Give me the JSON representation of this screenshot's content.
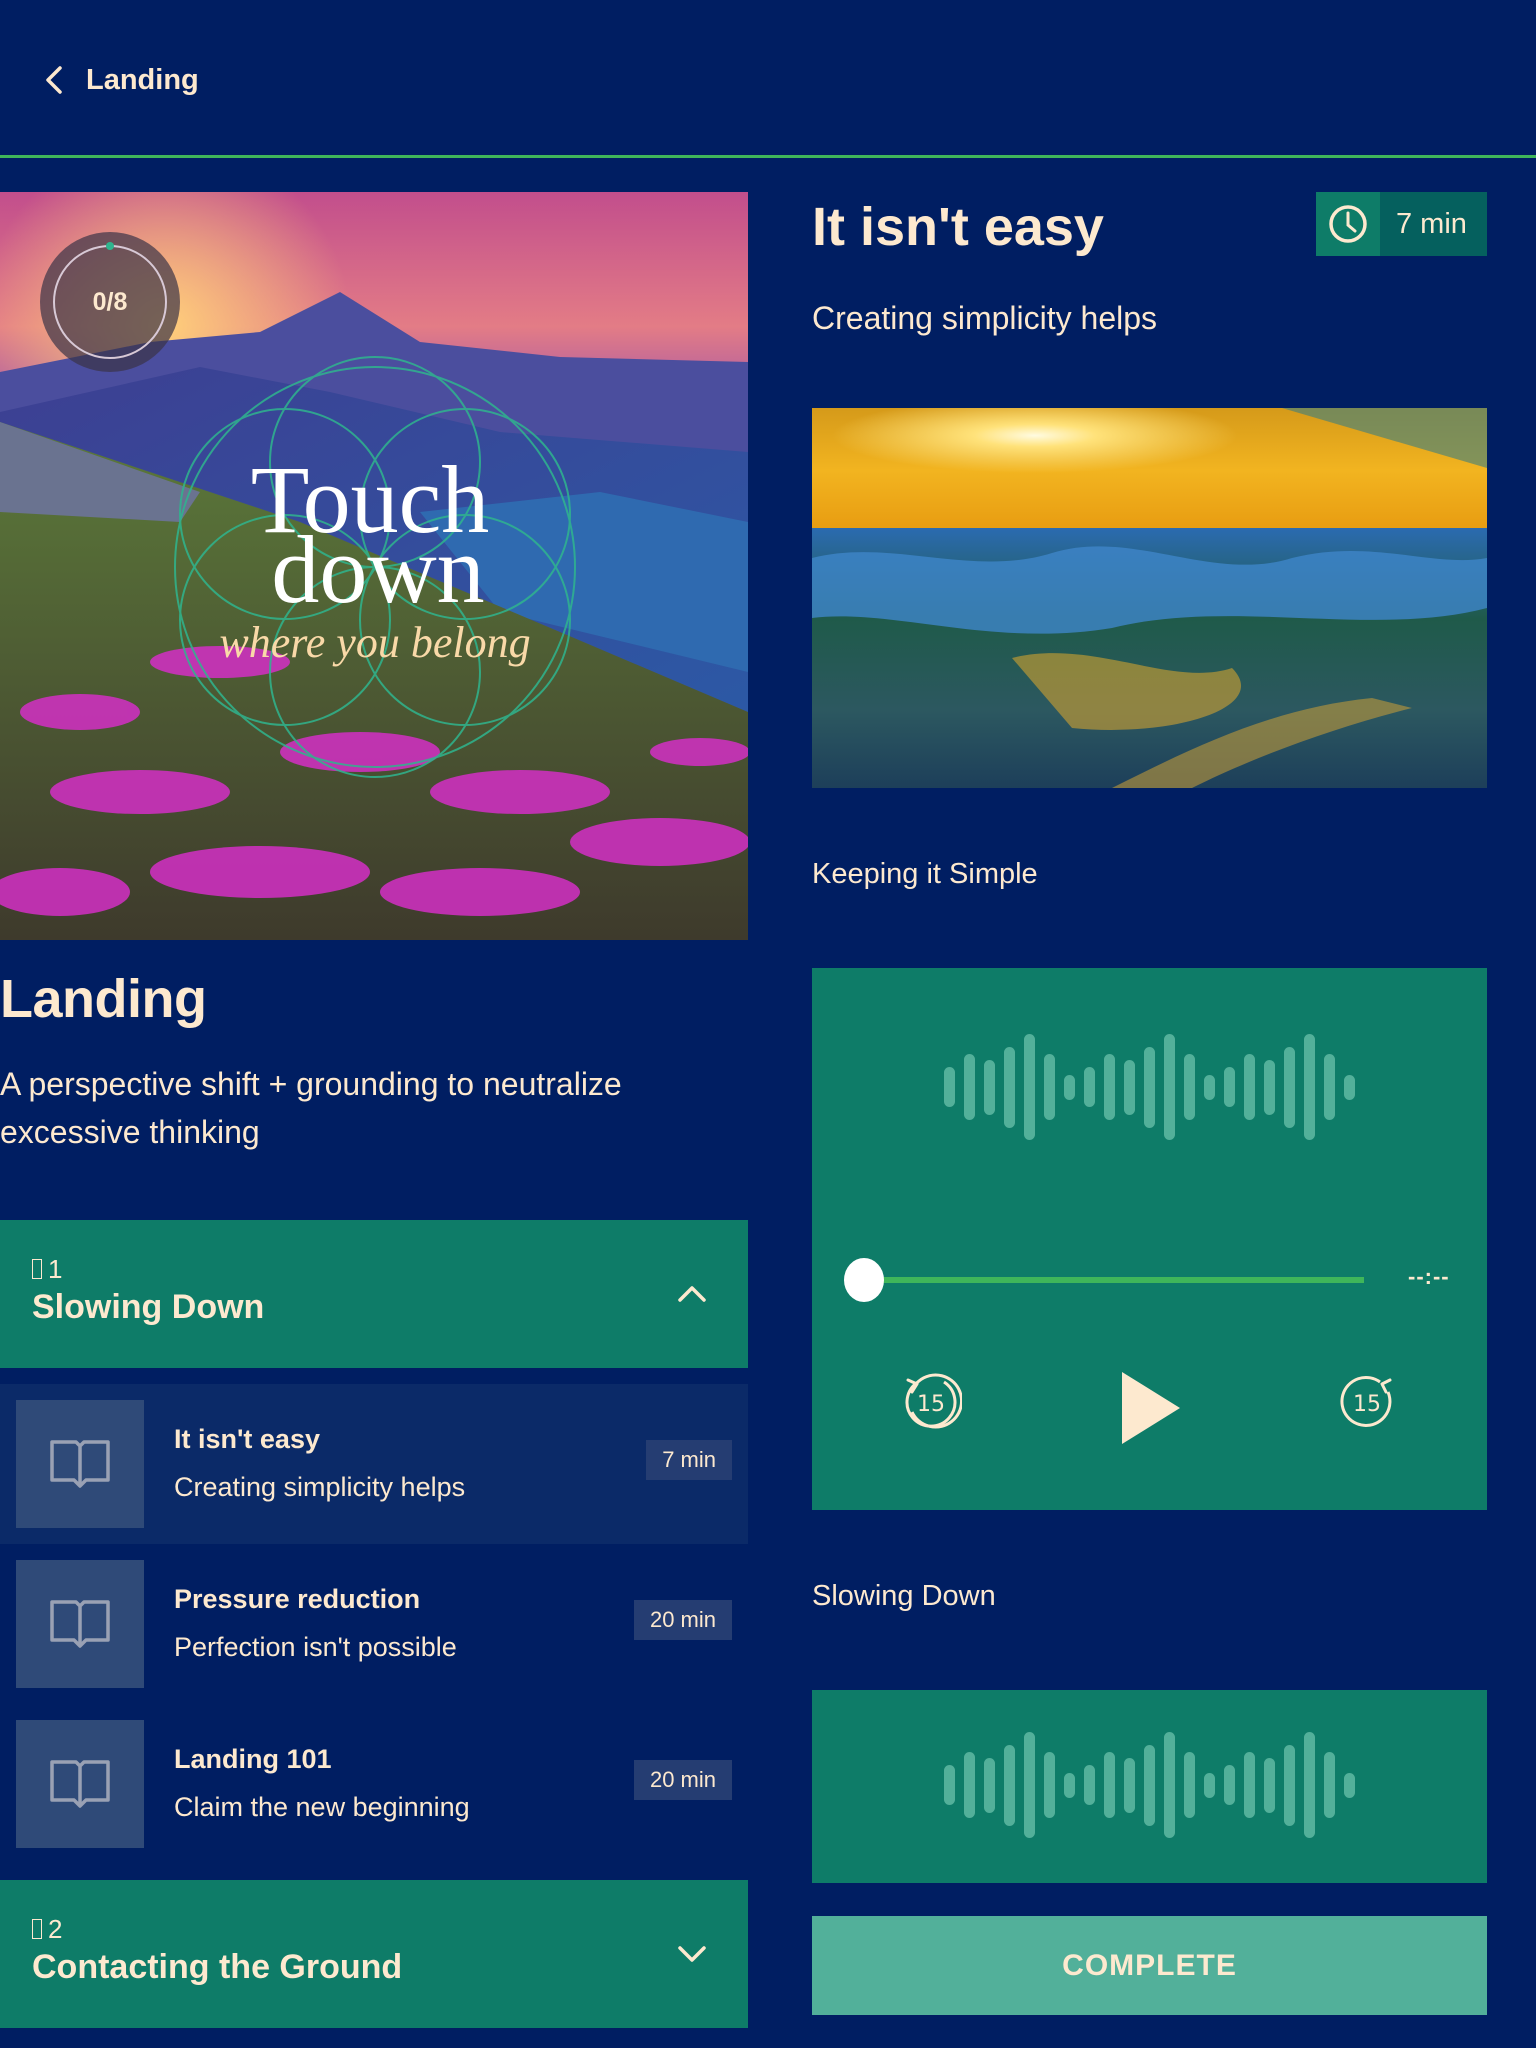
{
  "header": {
    "back_label": "Landing",
    "back_icon": "chevron-left-icon"
  },
  "course": {
    "progress_text": "0/8",
    "progress": {
      "completed": 0,
      "total": 8
    },
    "cover_title_line1": "Touch",
    "cover_title_line2": "down",
    "cover_tagline": "where you belong",
    "title": "Landing",
    "description": "A perspective shift  + grounding to neutralize excessive thinking"
  },
  "sections": [
    {
      "number": "1",
      "number_glyph": "missing-glyph",
      "title": "Slowing Down",
      "expanded": true,
      "lessons": [
        {
          "title": "It isn't easy",
          "subtitle": "Creating simplicity helps",
          "duration": "7 min",
          "icon": "book-open-icon",
          "active": true
        },
        {
          "title": "Pressure reduction",
          "subtitle": "Perfection isn't possible",
          "duration": "20 min",
          "icon": "book-open-icon",
          "active": false
        },
        {
          "title": "Landing 101",
          "subtitle": "Claim the new beginning",
          "duration": "20 min",
          "icon": "book-open-icon",
          "active": false
        }
      ]
    },
    {
      "number": "2",
      "number_glyph": "missing-glyph",
      "title": "Contacting the Ground",
      "expanded": false
    }
  ],
  "lesson_detail": {
    "title": "It isn't easy",
    "duration": "7 min",
    "subtitle": "Creating simplicity helps",
    "image_label": "Keeping it Simple",
    "audio_time": "--:--",
    "audio_progress": 0,
    "rewind_label": "15",
    "forward_label": "15",
    "second_audio_label": "Slowing Down",
    "complete_label": "COMPLETE"
  },
  "colors": {
    "background": "#001e62",
    "accent_green": "#0e7c68",
    "accent_line": "#3fb65a",
    "button_teal": "#52b09a",
    "text_cream": "#fde9cf"
  }
}
